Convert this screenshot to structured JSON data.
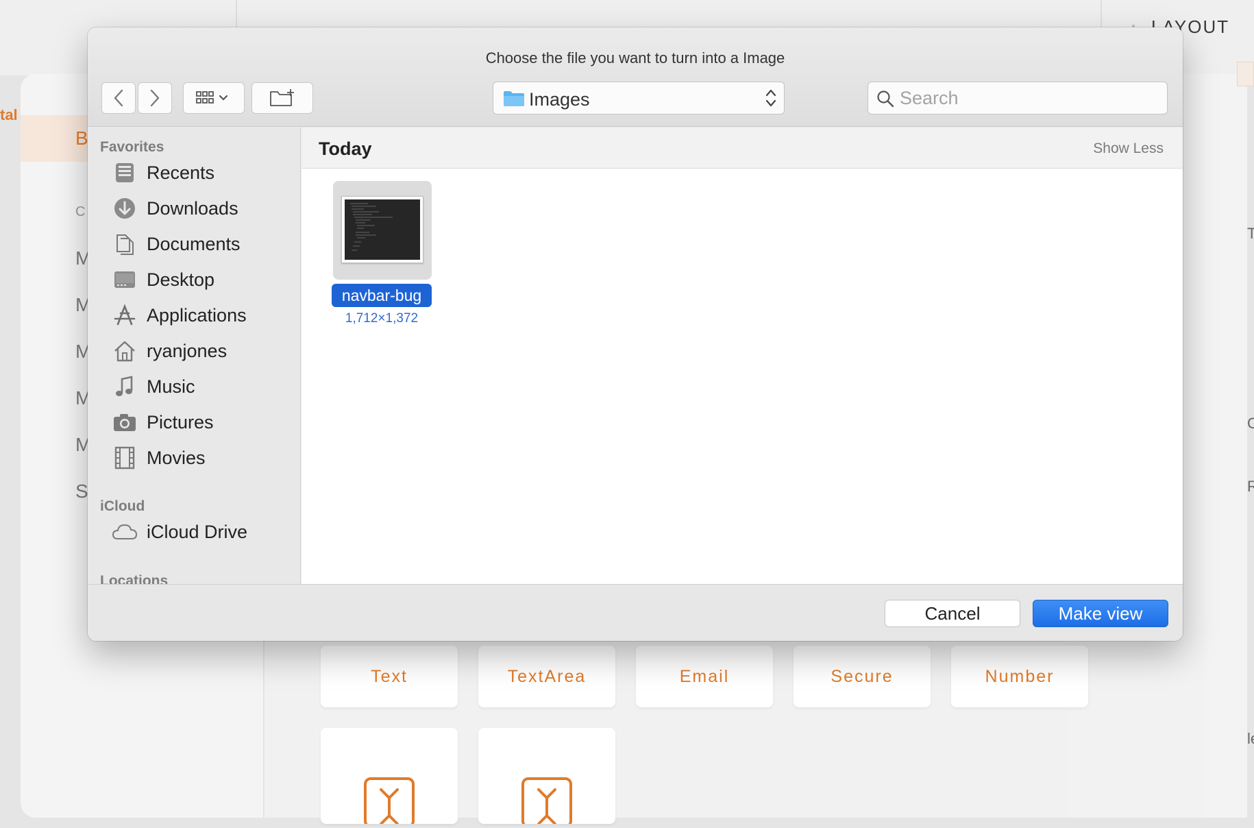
{
  "background": {
    "partial_label_left": "tal",
    "layout_label": "LAYOUT",
    "sidebar_items": [
      {
        "label": "B",
        "active": true
      },
      {
        "label": "C",
        "small": true
      },
      {
        "label": "M"
      },
      {
        "label": "M"
      },
      {
        "label": "M"
      },
      {
        "label": "M"
      },
      {
        "label": "M"
      },
      {
        "label": "S"
      }
    ],
    "right_glyphs": [
      "T",
      "C",
      "R",
      "le"
    ],
    "tiles": [
      "Text",
      "TextArea",
      "Email",
      "Secure",
      "Number"
    ],
    "accent_color": "#e07b2a"
  },
  "dialog": {
    "title": "Choose the file you want to turn into a Image",
    "toolbar": {
      "back_icon": "chevron-left-icon",
      "forward_icon": "chevron-right-icon",
      "view_icon": "grid-view-icon",
      "new_folder_icon": "new-folder-icon"
    },
    "location": {
      "label": "Images",
      "icon": "folder-icon"
    },
    "search": {
      "placeholder": "Search"
    },
    "sidebar": {
      "sections": [
        {
          "title": "Favorites",
          "items": [
            {
              "label": "Recents",
              "icon": "recents-icon"
            },
            {
              "label": "Downloads",
              "icon": "downloads-icon"
            },
            {
              "label": "Documents",
              "icon": "documents-icon"
            },
            {
              "label": "Desktop",
              "icon": "desktop-icon"
            },
            {
              "label": "Applications",
              "icon": "applications-icon"
            },
            {
              "label": "ryanjones",
              "icon": "home-icon"
            },
            {
              "label": "Music",
              "icon": "music-icon"
            },
            {
              "label": "Pictures",
              "icon": "camera-icon"
            },
            {
              "label": "Movies",
              "icon": "film-icon"
            }
          ]
        },
        {
          "title": "iCloud",
          "items": [
            {
              "label": "iCloud Drive",
              "icon": "cloud-icon"
            }
          ]
        },
        {
          "title": "Locations",
          "items": []
        }
      ]
    },
    "content": {
      "heading": "Today",
      "show_less": "Show Less",
      "files": [
        {
          "name": "navbar-bug",
          "dimensions": "1,712×1,372",
          "selected": true
        }
      ]
    },
    "footer": {
      "cancel_label": "Cancel",
      "confirm_label": "Make view"
    },
    "selection_color": "#1e63d4"
  }
}
